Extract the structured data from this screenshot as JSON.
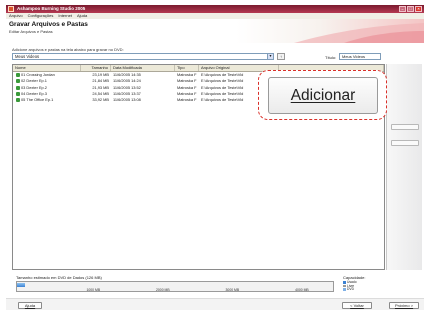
{
  "window": {
    "title": "Ashampoo Burning Studio 2005"
  },
  "menu": [
    "Arquivo",
    "Configurações",
    "Internet",
    "Ajuda"
  ],
  "header": {
    "title": "Gravar Arquivos e Pastas",
    "subtitle": "Editar Arquivos e Pastas"
  },
  "toolbar": {
    "instruction": "Adicione arquivos e pastas na tela abaixo para gravar no DVD:",
    "path_value": "Meus Videos",
    "up_label": "↑",
    "title_label": "Título:",
    "title_value": "Meus Videos"
  },
  "table": {
    "columns": [
      "Nome",
      "Tamanho",
      "Data Modificada",
      "Tipo",
      "Arquivo Original",
      ""
    ],
    "rows": [
      {
        "name": "01 Crossing Jordan",
        "size": "23,19 MB",
        "date": "11/6/2005 14:35",
        "type": "Matroska F",
        "orig": "E:\\Arquivos de Teste\\Vid"
      },
      {
        "name": "02 Dexter Ep.1",
        "size": "21,84 MB",
        "date": "11/6/2005 14:24",
        "type": "Matroska F",
        "orig": "E:\\Arquivos de Teste\\Vid"
      },
      {
        "name": "03 Dexter Ep.2",
        "size": "21,93 MB",
        "date": "11/6/2005 13:52",
        "type": "Matroska F",
        "orig": "E:\\Arquivos de Teste\\Vid"
      },
      {
        "name": "04 Dexter Ep.3",
        "size": "24,54 MB",
        "date": "11/6/2005 13:37",
        "type": "Matroska F",
        "orig": "E:\\Arquivos de Teste\\Vid"
      },
      {
        "name": "05 The Office Ep.1",
        "size": "33,92 MB",
        "date": "11/6/2005 13:08",
        "type": "Matroska F",
        "orig": "E:\\Arquivos de Teste\\Vid"
      }
    ]
  },
  "add_button": {
    "label": "Adicionar"
  },
  "capacity": {
    "size_label": "Tamanho estimado em DVD de Dados (126 MB)",
    "capacity_label": "Capacidade:",
    "used_fraction": 0.025,
    "ticks": [
      "1000 MB",
      "2000 MB",
      "3000 MB",
      "4000 MB"
    ],
    "legend": [
      "Usado",
      "Livre",
      "DVD"
    ]
  },
  "footer": {
    "help": "Ajuda",
    "back": "< Voltar",
    "next": "Próximo >"
  },
  "colors": {
    "titlebar": "#a2324a",
    "callout": "#d9302a",
    "fill": "#3c82d4"
  }
}
